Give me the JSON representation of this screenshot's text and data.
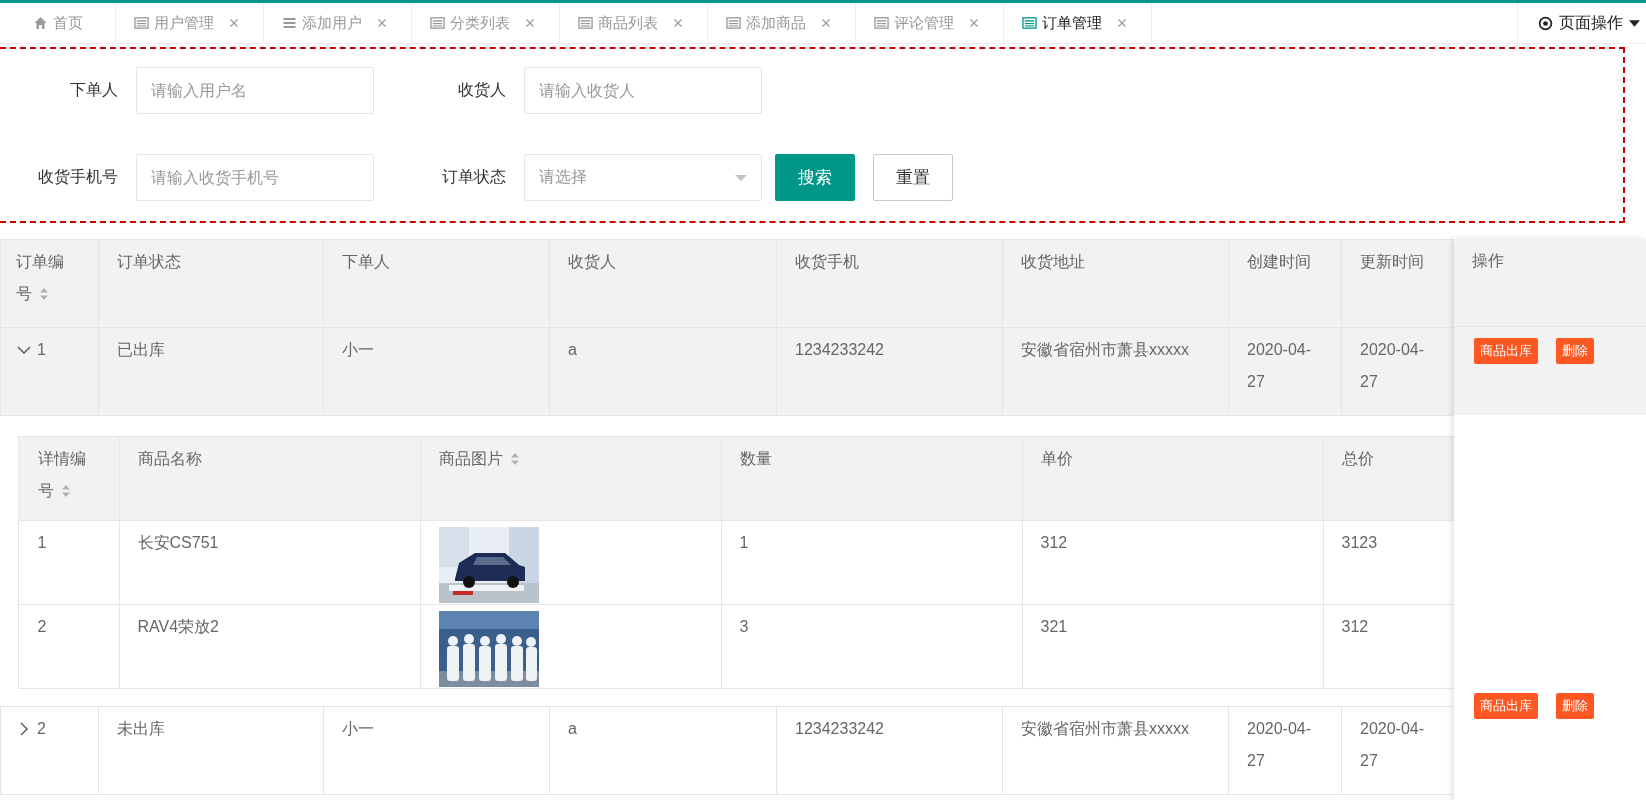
{
  "tabs": [
    {
      "label": "首页",
      "closable": false,
      "selected": false
    },
    {
      "label": "用户管理",
      "closable": true,
      "selected": false
    },
    {
      "label": "添加用户",
      "closable": true,
      "selected": false
    },
    {
      "label": "分类列表",
      "closable": true,
      "selected": false
    },
    {
      "label": "商品列表",
      "closable": true,
      "selected": false
    },
    {
      "label": "添加商品",
      "closable": true,
      "selected": false
    },
    {
      "label": "评论管理",
      "closable": true,
      "selected": false
    },
    {
      "label": "订单管理",
      "closable": true,
      "selected": true
    }
  ],
  "page_menu": {
    "label": "页面操作"
  },
  "search": {
    "rows": [
      [
        {
          "label": "下单人",
          "kind": "input",
          "placeholder": "请输入用户名"
        },
        {
          "label": "收货人",
          "kind": "input",
          "placeholder": "请输入收货人"
        }
      ],
      [
        {
          "label": "收货手机号",
          "kind": "input",
          "placeholder": "请输入收货手机号"
        },
        {
          "label": "订单状态",
          "kind": "select",
          "placeholder": "请选择"
        }
      ]
    ],
    "buttons": [
      {
        "label": "搜索",
        "kind": "primary"
      },
      {
        "label": "重置",
        "kind": "plain"
      }
    ]
  },
  "orders": {
    "columns": [
      {
        "label": "订单编号",
        "sortable": true
      },
      {
        "label": "订单状态",
        "sortable": false
      },
      {
        "label": "下单人",
        "sortable": false
      },
      {
        "label": "收货人",
        "sortable": false
      },
      {
        "label": "收货手机",
        "sortable": false
      },
      {
        "label": "收货地址",
        "sortable": false
      },
      {
        "label": "创建时间",
        "sortable": false
      },
      {
        "label": "更新时间",
        "sortable": false
      }
    ],
    "rows": [
      {
        "expanded": true,
        "cells": [
          "1",
          "已出库",
          "小一",
          "a",
          "1234233242",
          "安徽省宿州市萧县xxxxx",
          "2020-04-27",
          "2020-04-27"
        ],
        "details": {
          "columns": [
            {
              "label": "详情编号",
              "sortable": true
            },
            {
              "label": "商品名称",
              "sortable": false
            },
            {
              "label": "商品图片",
              "sortable": true
            },
            {
              "label": "数量",
              "sortable": false
            },
            {
              "label": "单价",
              "sortable": false
            },
            {
              "label": "总价",
              "sortable": false
            }
          ],
          "rows": [
            {
              "number": "1",
              "name": "长安CS751",
              "quantity": "1",
              "unit_price": "312",
              "total": "3123"
            },
            {
              "number": "2",
              "name": "RAV4荣放2",
              "quantity": "3",
              "unit_price": "321",
              "total": "312"
            }
          ]
        }
      },
      {
        "expanded": false,
        "cells": [
          "2",
          "未出库",
          "小一",
          "a",
          "1234233242",
          "安徽省宿州市萧县xxxxx",
          "2020-04-27",
          "2020-04-27"
        ]
      }
    ]
  },
  "actions": {
    "header": "操作",
    "rows": [
      {
        "buttons": [
          "商品出库",
          "删除"
        ]
      },
      {
        "buttons": [
          "商品出库",
          "删除"
        ]
      }
    ]
  }
}
